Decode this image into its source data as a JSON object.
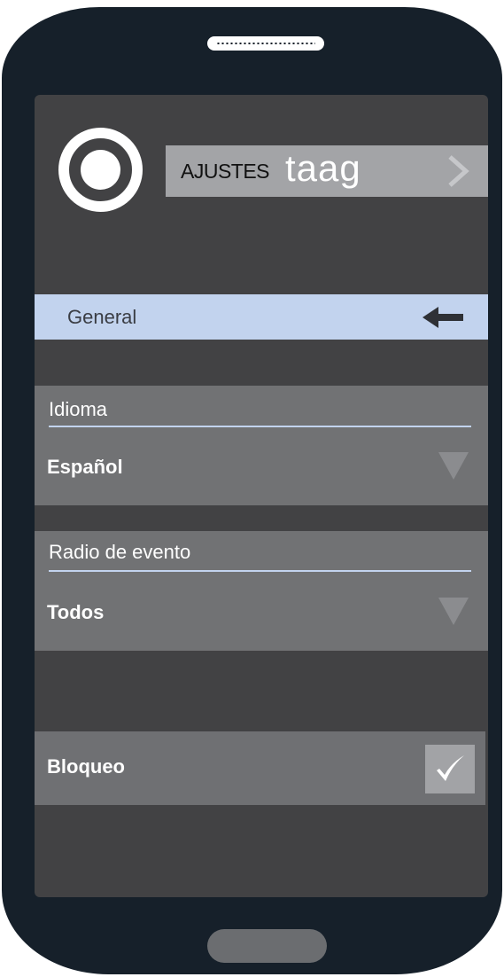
{
  "header": {
    "title_small": "AJUSTES",
    "brand": "taag",
    "logo_icon": "app-logo-ring-icon",
    "next_icon": "chevron-right-icon"
  },
  "sections": {
    "general": {
      "label": "General",
      "back_icon": "arrow-left-icon"
    },
    "language": {
      "label": "Idioma",
      "value": "Español",
      "dropdown_icon": "triangle-down-icon"
    },
    "event_radius": {
      "label": "Radio de evento",
      "value": "Todos",
      "dropdown_icon": "triangle-down-icon"
    },
    "lock": {
      "label": "Bloqueo",
      "checked": true,
      "check_icon": "checkmark-icon"
    }
  },
  "colors": {
    "phone_body": "#16202a",
    "screen_bg": "#424244",
    "section_highlight": "#c2d3ee",
    "panel_bg": "#717274",
    "title_bar": "#a3a4a7"
  }
}
